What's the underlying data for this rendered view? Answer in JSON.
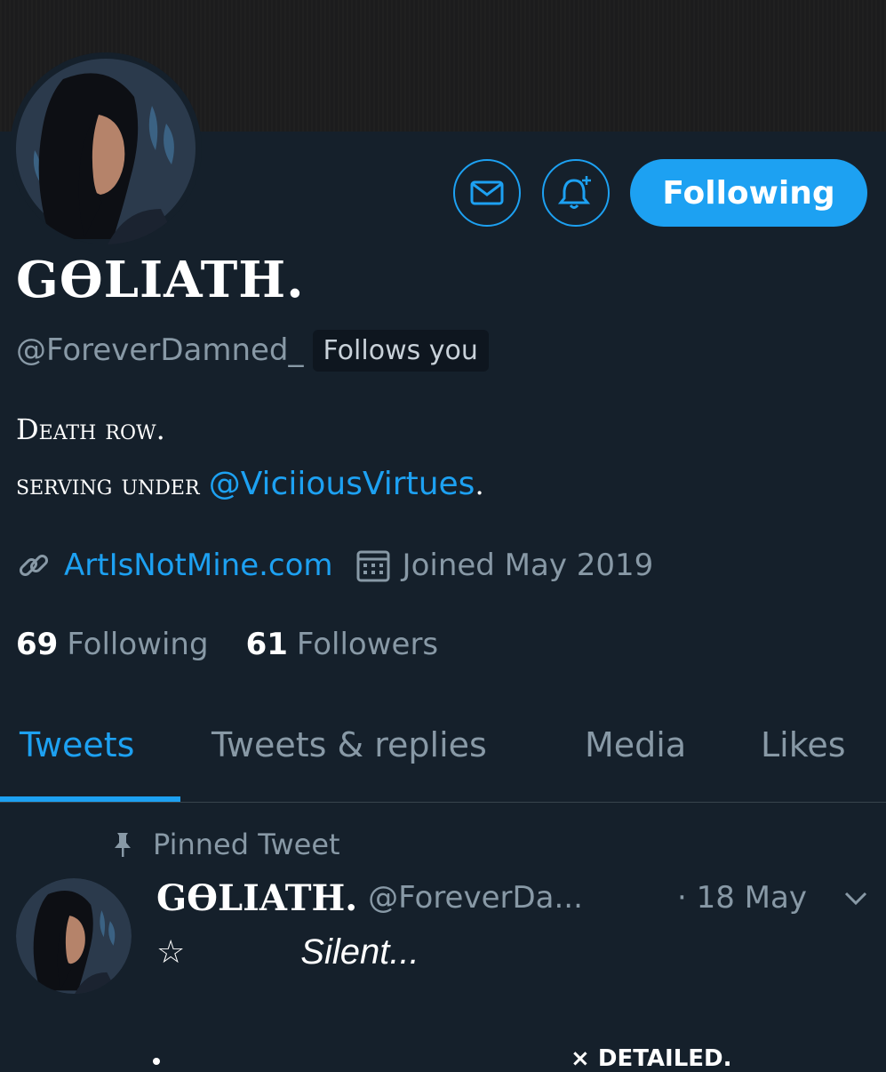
{
  "profile": {
    "name": "GӨLIATH.",
    "handle": "@ForeverDamned_",
    "follows_you": "Follows you",
    "bio_line1": "Death row.",
    "bio_line2_prefix": "serving under",
    "bio_mention": "@ViciiousVirtues",
    "bio_line2_suffix": ".",
    "website": "ArtIsNotMine.com",
    "joined": "Joined May 2019",
    "following_count": "69",
    "following_label": "Following",
    "followers_count": "61",
    "followers_label": "Followers"
  },
  "actions": {
    "message_icon": "envelope-icon",
    "notify_icon": "bell-plus-icon",
    "follow_label": "Following"
  },
  "tabs": [
    {
      "label": "Tweets",
      "active": true
    },
    {
      "label": "Tweets & replies",
      "active": false
    },
    {
      "label": "Media",
      "active": false
    },
    {
      "label": "Likes",
      "active": false
    }
  ],
  "pinned_tweet": {
    "pinned_label": "Pinned Tweet",
    "author_name": "GӨLIATH.",
    "author_handle": "@ForeverDa...",
    "date": "· 18 May",
    "star": "☆",
    "text": "Silent...",
    "detailed_prefix": "×",
    "detailed_text": "DETAILED."
  },
  "colors": {
    "background": "#15202b",
    "accent": "#1da1f2",
    "muted": "#8899a6"
  }
}
